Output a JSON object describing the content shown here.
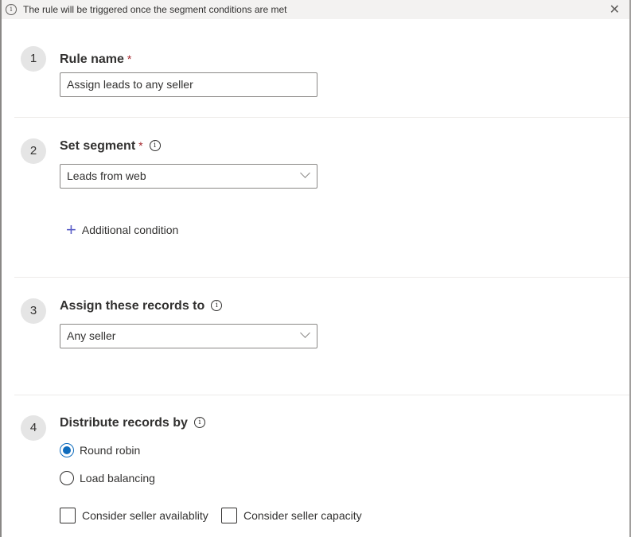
{
  "banner": {
    "icon": "info-icon",
    "message": "The rule will be triggered once the segment conditions are met",
    "close_icon": "close-icon"
  },
  "steps": [
    {
      "number": "1",
      "label": "Rule name",
      "required": "*",
      "field_value": "Assign leads to any seller"
    },
    {
      "number": "2",
      "label": "Set segment",
      "required": "*",
      "info": "i",
      "dropdown_value": "Leads from web",
      "add_condition_label": "Additional condition"
    },
    {
      "number": "3",
      "label": "Assign these records to",
      "info": "i",
      "dropdown_value": "Any seller"
    },
    {
      "number": "4",
      "label": "Distribute records by",
      "info": "i",
      "radio_options": [
        {
          "label": "Round robin",
          "selected": true
        },
        {
          "label": "Load balancing",
          "selected": false
        }
      ],
      "checkboxes": [
        {
          "label": "Consider seller availablity",
          "checked": false
        },
        {
          "label": "Consider seller capacity",
          "checked": false
        }
      ]
    }
  ],
  "colors": {
    "accent": "#0f6cbd",
    "required": "#a4262c",
    "plus": "#5b5fc7"
  }
}
